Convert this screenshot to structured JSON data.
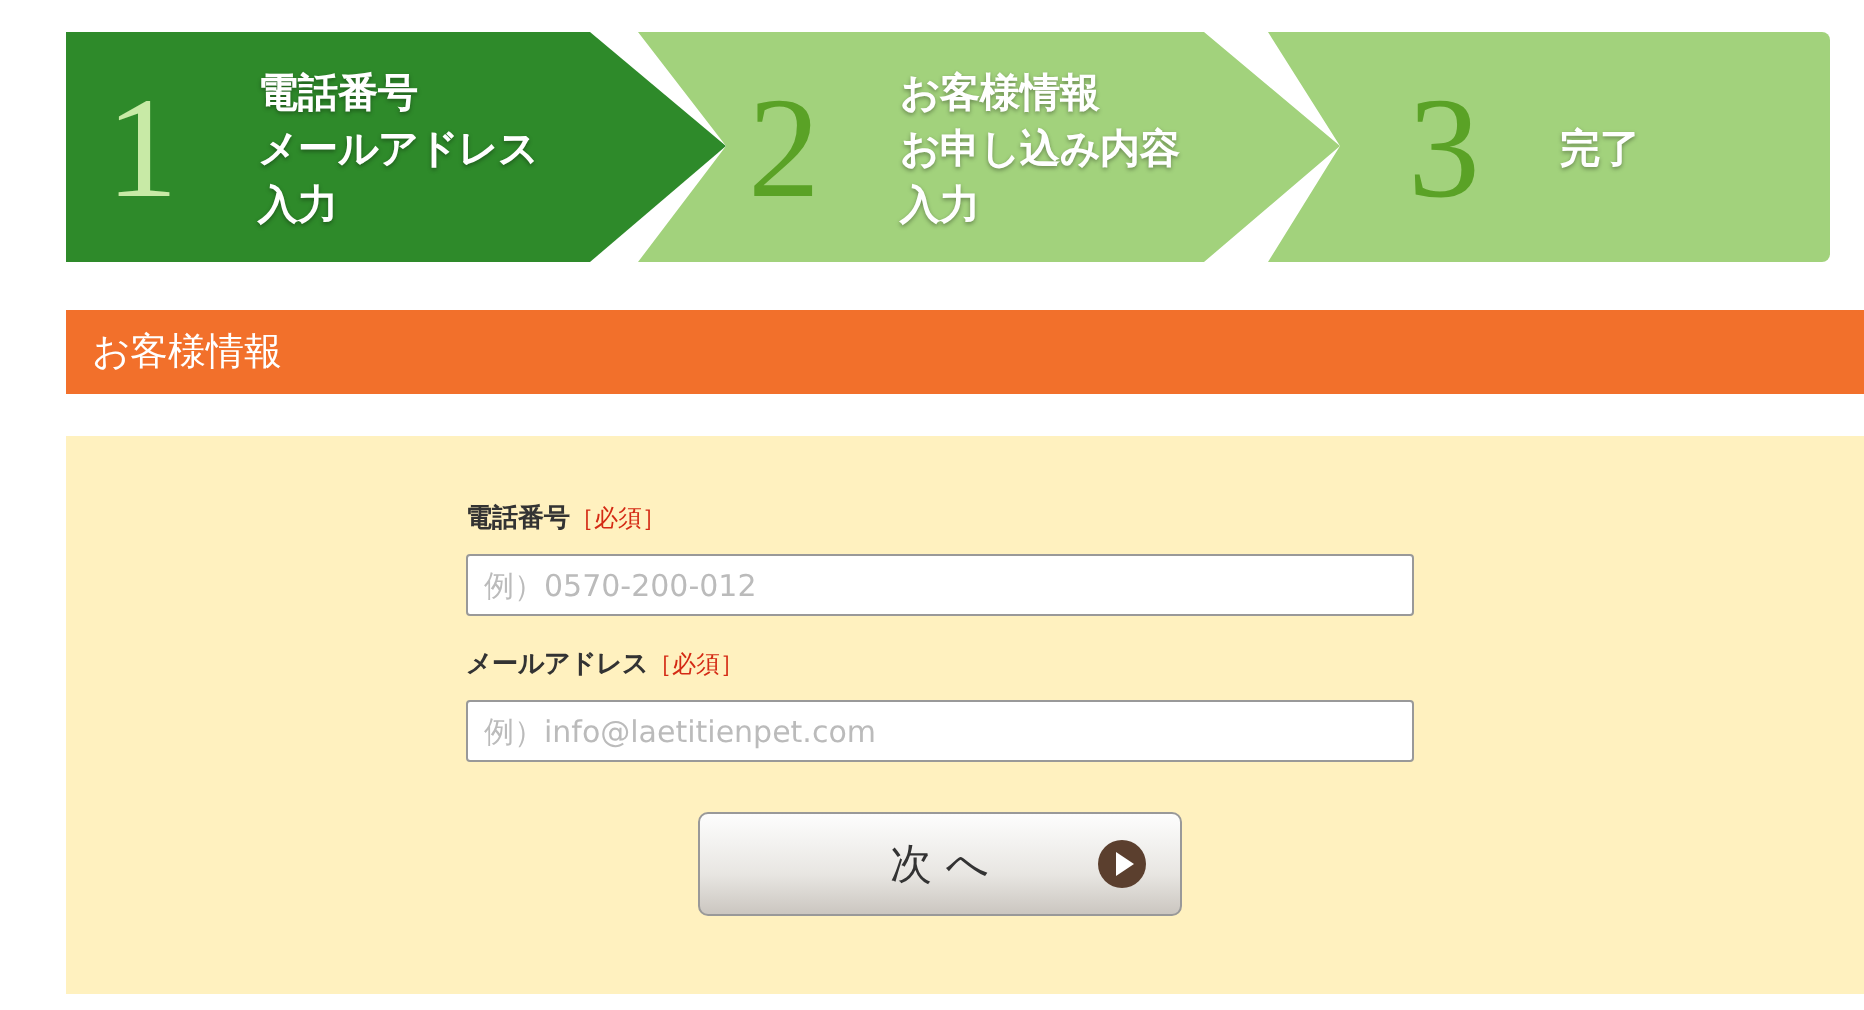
{
  "steps": [
    {
      "number": "1",
      "lines": [
        "電話番号",
        "メールアドレス",
        "入力"
      ],
      "selected": true
    },
    {
      "number": "2",
      "lines": [
        "お客様情報",
        "お申し込み内容",
        "入力"
      ],
      "selected": false
    },
    {
      "number": "3",
      "lines": [
        "完了"
      ],
      "selected": false
    }
  ],
  "section_title": "お客様情報",
  "fields": [
    {
      "label": "電話番号",
      "required": "［必須］",
      "placeholder": "例）0570-200-012"
    },
    {
      "label": "メールアドレス",
      "required": "［必須］",
      "placeholder": "例）info@laetitienpet.com"
    }
  ],
  "next_button": "次 へ"
}
